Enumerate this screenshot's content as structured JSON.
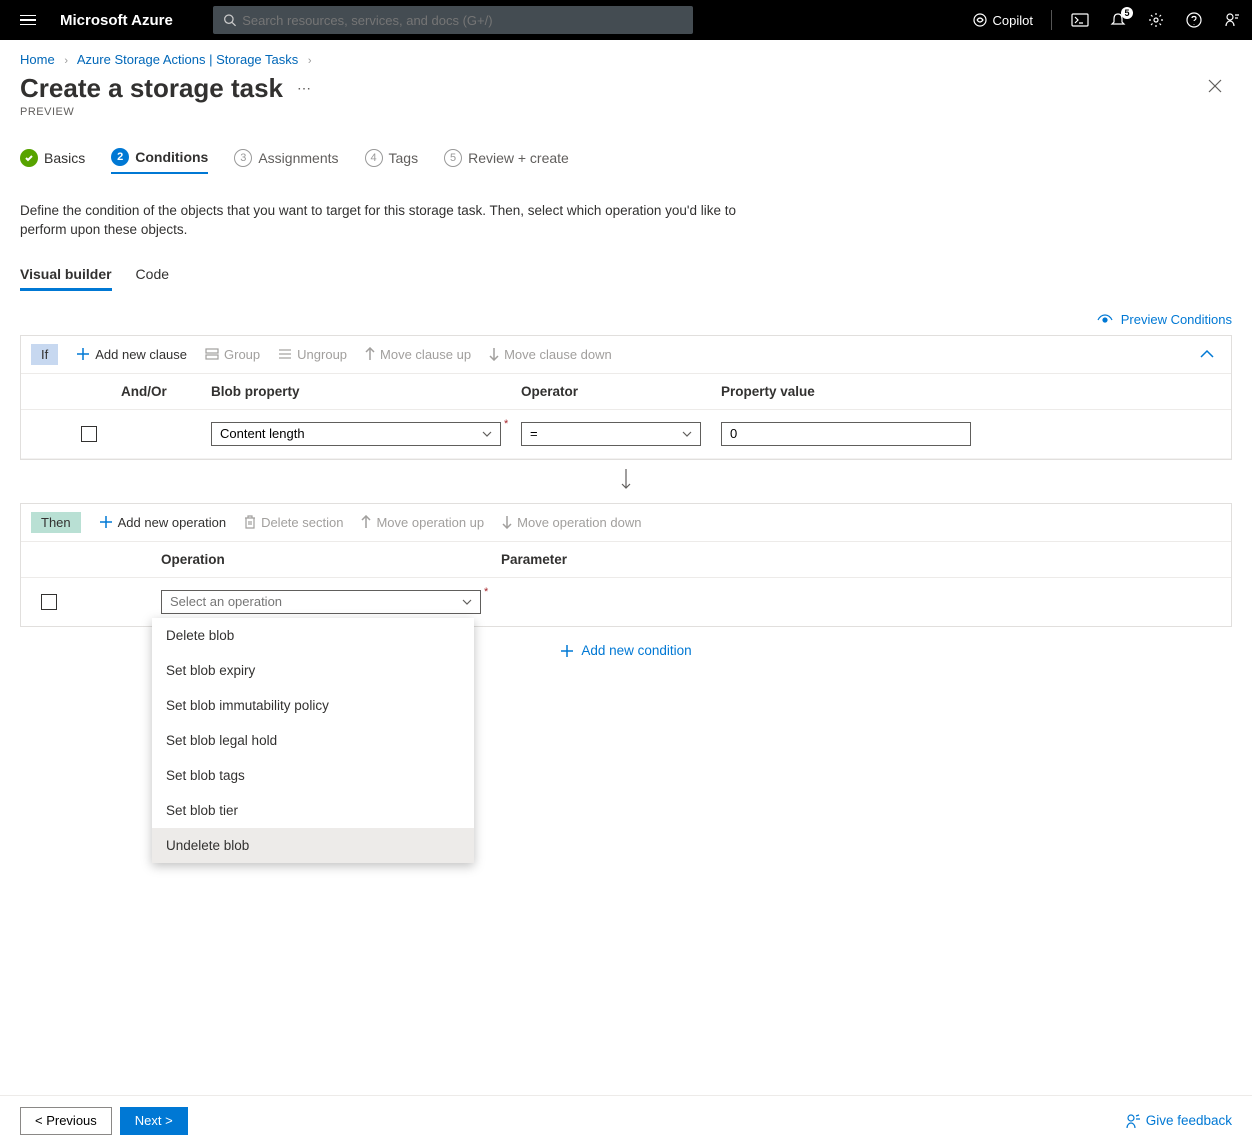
{
  "topbar": {
    "brand": "Microsoft Azure",
    "search_placeholder": "Search resources, services, and docs (G+/)",
    "copilot": "Copilot",
    "notif_count": "5"
  },
  "breadcrumb": {
    "home": "Home",
    "parent": "Azure Storage Actions | Storage Tasks"
  },
  "page": {
    "title": "Create a storage task",
    "preview": "PREVIEW"
  },
  "steps": {
    "s1": "Basics",
    "s2": "Conditions",
    "s3": "Assignments",
    "s4": "Tags",
    "s5": "Review + create",
    "n2": "2",
    "n3": "3",
    "n4": "4",
    "n5": "5"
  },
  "description": "Define the condition of the objects that you want to target for this storage task. Then, select which operation you'd like to perform upon these objects.",
  "subtabs": {
    "builder": "Visual builder",
    "code": "Code"
  },
  "preview_link": "Preview Conditions",
  "if_block": {
    "chip": "If",
    "add": "Add new clause",
    "group": "Group",
    "ungroup": "Ungroup",
    "move_up": "Move clause up",
    "move_down": "Move clause down",
    "headers": {
      "andor": "And/Or",
      "prop": "Blob property",
      "op": "Operator",
      "val": "Property value"
    },
    "row": {
      "prop": "Content length",
      "op": "=",
      "val": "0"
    }
  },
  "then_block": {
    "chip": "Then",
    "add": "Add new operation",
    "delete": "Delete section",
    "move_up": "Move operation up",
    "move_down": "Move operation down",
    "headers": {
      "op": "Operation",
      "param": "Parameter"
    },
    "placeholder": "Select an operation"
  },
  "dropdown": {
    "o1": "Delete blob",
    "o2": "Set blob expiry",
    "o3": "Set blob immutability policy",
    "o4": "Set blob legal hold",
    "o5": "Set blob tags",
    "o6": "Set blob tier",
    "o7": "Undelete blob"
  },
  "add_condition": "Add new condition",
  "footer": {
    "prev": "< Previous",
    "next": "Next >",
    "feedback": "Give feedback"
  }
}
